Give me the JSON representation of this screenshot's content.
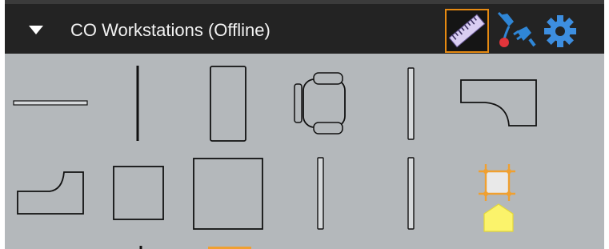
{
  "panel": {
    "title": "CO Workstations (Offline)"
  },
  "icons": {
    "collapse": "triangle-down-icon",
    "measure": "ruler-icon",
    "connect": "plug-connect-icon",
    "settings": "gear-icon"
  },
  "colors": {
    "header_bg": "#232323",
    "palette_bg": "#b4b8bb",
    "selected_tool_border": "#e68a12",
    "settings_gear": "#3d8ee0",
    "marker_orange": "#f0a030",
    "marker_yellow": "#fbf36b"
  },
  "palette_items": [
    "horizontal-line",
    "vertical-line",
    "tall-rectangle",
    "office-chair",
    "narrow-vertical-panel",
    "l-desk-right",
    "l-desk-left",
    "small-square",
    "large-square",
    "narrow-vertical-panel",
    "narrow-vertical-panel",
    "selected-square-marker",
    "home-marker"
  ]
}
